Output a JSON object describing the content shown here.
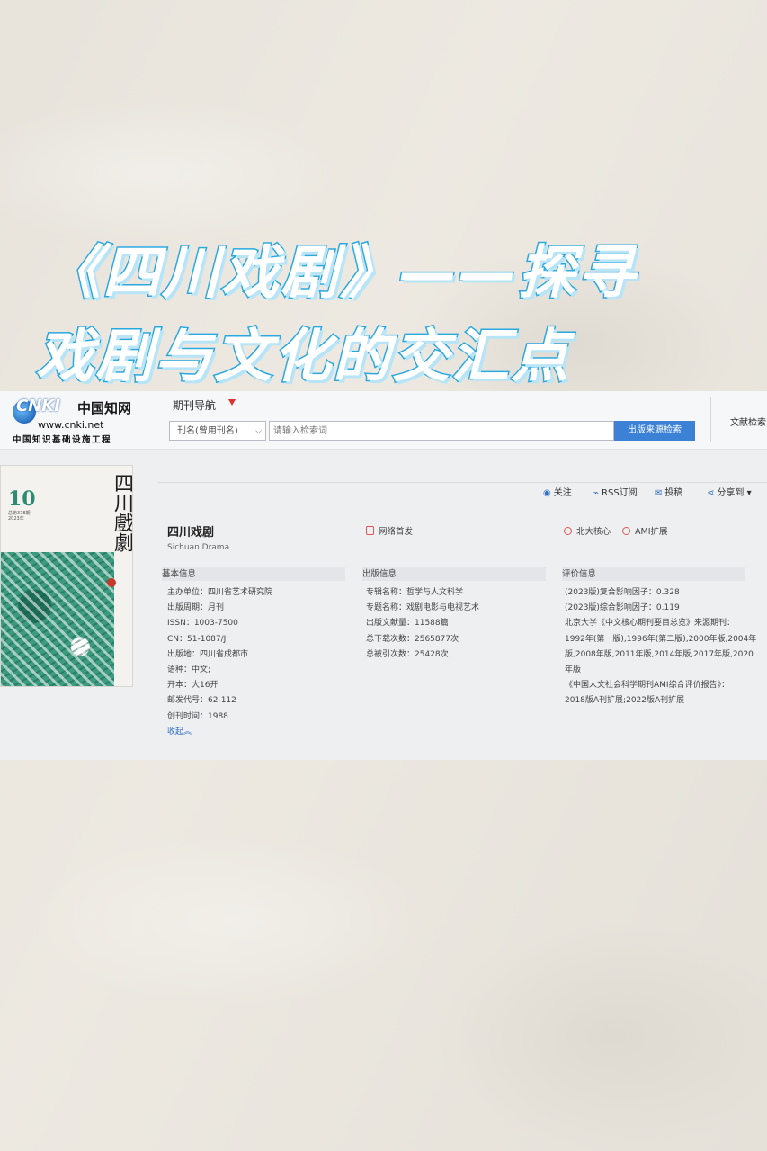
{
  "headline": {
    "line1": "《四川戏剧》——探寻",
    "line2": "戏剧与文化的交汇点"
  },
  "logo": {
    "mark": "CNKI",
    "cn_name": "中国知网",
    "url": "www.cnki.net",
    "subtitle": "中国知识基础设施工程"
  },
  "header": {
    "nav_label": "期刊导航",
    "select_value": "刊名(曾用刊名)",
    "search_placeholder": "请输入检索词",
    "search_button": "出版来源检索",
    "right_link": "文献检索"
  },
  "cover": {
    "issue_number": "10",
    "issue_detail": "总第378期\n2023年",
    "title": "四川戲劇"
  },
  "toolbar": {
    "follow": "关注",
    "rss": "RSS订阅",
    "submit": "投稿",
    "share": "分享到 ▾"
  },
  "journal": {
    "title": "四川戏剧",
    "title_en": "Sichuan Drama",
    "network_first": "网络首发",
    "core_badge": "北大核心",
    "ami_badge": "AMI扩展"
  },
  "basic_info": {
    "heading": "基本信息",
    "rows": [
      "主办单位：四川省艺术研究院",
      "出版周期：月刊",
      "ISSN：1003-7500",
      "CN：51-1087/J",
      "出版地：四川省成都市",
      "语种：中文;",
      "开本：大16开",
      "邮发代号：62-112",
      "创刊时间：1988"
    ],
    "collapse": "收起"
  },
  "publish_info": {
    "heading": "出版信息",
    "rows": [
      "专辑名称：哲学与人文科学",
      "专题名称：戏剧电影与电视艺术",
      "出版文献量：11588篇",
      "总下载次数：2565877次",
      "总被引次数：25428次"
    ]
  },
  "eval_info": {
    "heading": "评价信息",
    "rows": [
      "(2023版)复合影响因子：0.328",
      "(2023版)综合影响因子：0.119",
      "北京大学《中文核心期刊要目总览》来源期刊：",
      "1992年(第一版),1996年(第二版),2000年版,2004年",
      "版,2008年版,2011年版,2014年版,2017年版,2020",
      "年版",
      "《中国人文社会科学期刊AMI综合评价报告》：",
      "2018版A刊扩展;2022版A刊扩展"
    ]
  },
  "colors": {
    "headline_stroke": "#2aa8e0",
    "search_button": "#3b82d6",
    "cover_green": "#3c9a7f",
    "badge_red": "#d55555"
  }
}
